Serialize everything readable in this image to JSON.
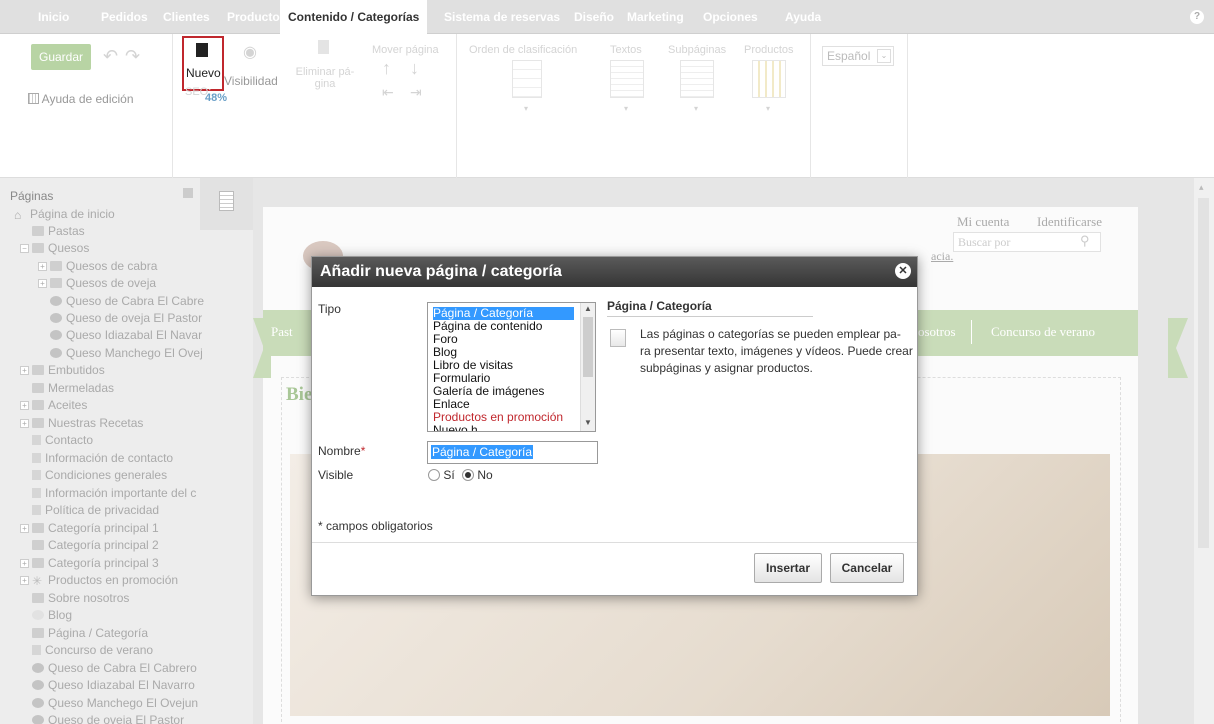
{
  "topnav": {
    "items": [
      "Inicio",
      "Pedidos",
      "Clientes",
      "Productos",
      "Contenido / Categorías",
      "Sistema de reservas",
      "Diseño",
      "Marketing",
      "Opciones",
      "Ayuda"
    ],
    "active_index": 4
  },
  "ribbon": {
    "save": "Guardar",
    "edit_help": "Ayuda de edición",
    "new": "Nuevo",
    "visibility": "Visibilidad",
    "seo": "SEO:",
    "seo_value": "48%",
    "delete_page": "Eliminar pá-gina",
    "move_page": "Mover página",
    "sort_order": "Orden de clasificación",
    "texts": "Textos",
    "subpages": "Subpáginas",
    "products": "Productos",
    "language": "Español"
  },
  "sidebar": {
    "title": "Páginas",
    "items": [
      "Página de inicio",
      "Pastas",
      "Quesos",
      "Quesos de cabra",
      "Quesos de oveja",
      "Queso de Cabra El Cabre",
      "Queso de oveja El Pastor",
      "Queso Idiazabal El Navar",
      "Queso Manchego El Ovej",
      "Embutidos",
      "Mermeladas",
      "Aceites",
      "Nuestras Recetas",
      "Contacto",
      "Información de contacto",
      "Condiciones generales",
      "Información importante del c",
      "Política de privacidad",
      "Categoría principal 1",
      "Categoría principal 2",
      "Categoría principal 3",
      "Productos en promoción",
      "Sobre nosotros",
      "Blog",
      "Página / Categoría",
      "Concurso de verano",
      "Queso de Cabra El Cabrero",
      "Queso Idiazabal El Navarro",
      "Queso Manchego El Ovejun",
      "Queso de oveja El Pastor"
    ]
  },
  "preview": {
    "my_account": "Mi cuenta",
    "login": "Identificarse",
    "search_placeholder": "Buscar por",
    "nav_left": "Past",
    "nav_about": "osotros",
    "nav_contest": "Concurso de verano",
    "welcome": "Bie",
    "link_text": "acia."
  },
  "modal": {
    "title": "Añadir nueva página / categoría",
    "type_label": "Tipo",
    "type_options": [
      "Página / Categoría",
      "Página de contenido",
      "Foro",
      "Blog",
      "Libro de visitas",
      "Formulario",
      "Galería de imágenes",
      "Enlace",
      "Productos en promoción",
      "Nuevo h..."
    ],
    "selected_type": 0,
    "info_title": "Página / Categoría",
    "info_text_1": "Las páginas o categorías se pueden emplear pa-",
    "info_text_2": "ra presentar texto, imágenes y vídeos. Puede crear",
    "info_text_3": "subpáginas y asignar productos.",
    "name_label": "Nombre",
    "required_mark": "*",
    "name_value": "Página / Categoría",
    "visible_label": "Visible",
    "yes": "Sí",
    "no": "No",
    "visible_value": "No",
    "required_note": "* campos obligatorios",
    "insert": "Insertar",
    "cancel": "Cancelar"
  },
  "colors": {
    "accent_green": "#9fbf85",
    "highlight_red": "#c0272d",
    "selection_blue": "#3399ff"
  }
}
